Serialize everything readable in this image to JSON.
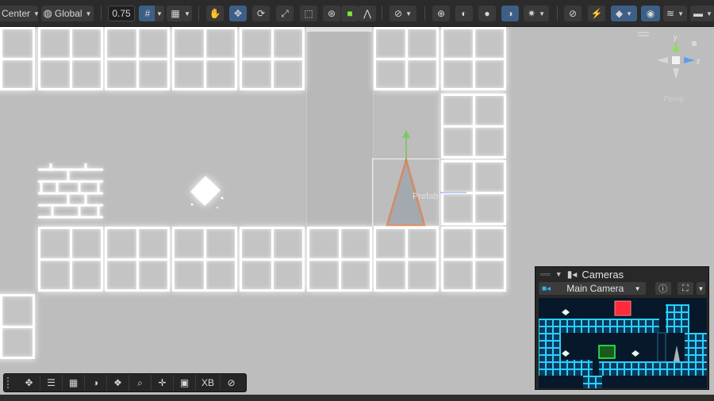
{
  "toolbar": {
    "pivot_label": "Center",
    "space_label": "Global",
    "snap_value": "0.75",
    "icons": [
      "grid-snap-icon",
      "grid-icon",
      "hand-tool-icon",
      "move-tool-icon",
      "rotate-tool-icon",
      "scale-tool-icon",
      "rect-tool-icon",
      "transform-tool-icon",
      "custom-tool-icon",
      "path-tool-icon",
      "gizmo-icon",
      "globe-icon",
      "shading-icon",
      "sphere-icon",
      "moon-icon",
      "effects-icon",
      "audio-mute-icon",
      "lighting-icon",
      "layers-icon",
      "visibility-icon",
      "scene-layers-icon",
      "camera-icon"
    ]
  },
  "gizmo": {
    "y_label": "y",
    "z_label": "z",
    "persp_label": "Persp"
  },
  "scene": {
    "prefab_label": "Prefab"
  },
  "bottom_toolbar": {
    "xb_label": "XB",
    "icons": [
      "move-icon",
      "align-icon",
      "grid-icon",
      "moon-icon",
      "layers-icon",
      "search-icon",
      "pivot-icon",
      "camera-icon",
      "compass-icon"
    ]
  },
  "cameras": {
    "title": "Cameras",
    "selected_camera": "Main Camera"
  },
  "colors": {
    "accent": "#3d5f86",
    "selection_orange": "#e8621c",
    "preview_blue": "#22b8ff",
    "preview_red": "#ff2a3a",
    "preview_green": "#2aff52"
  }
}
